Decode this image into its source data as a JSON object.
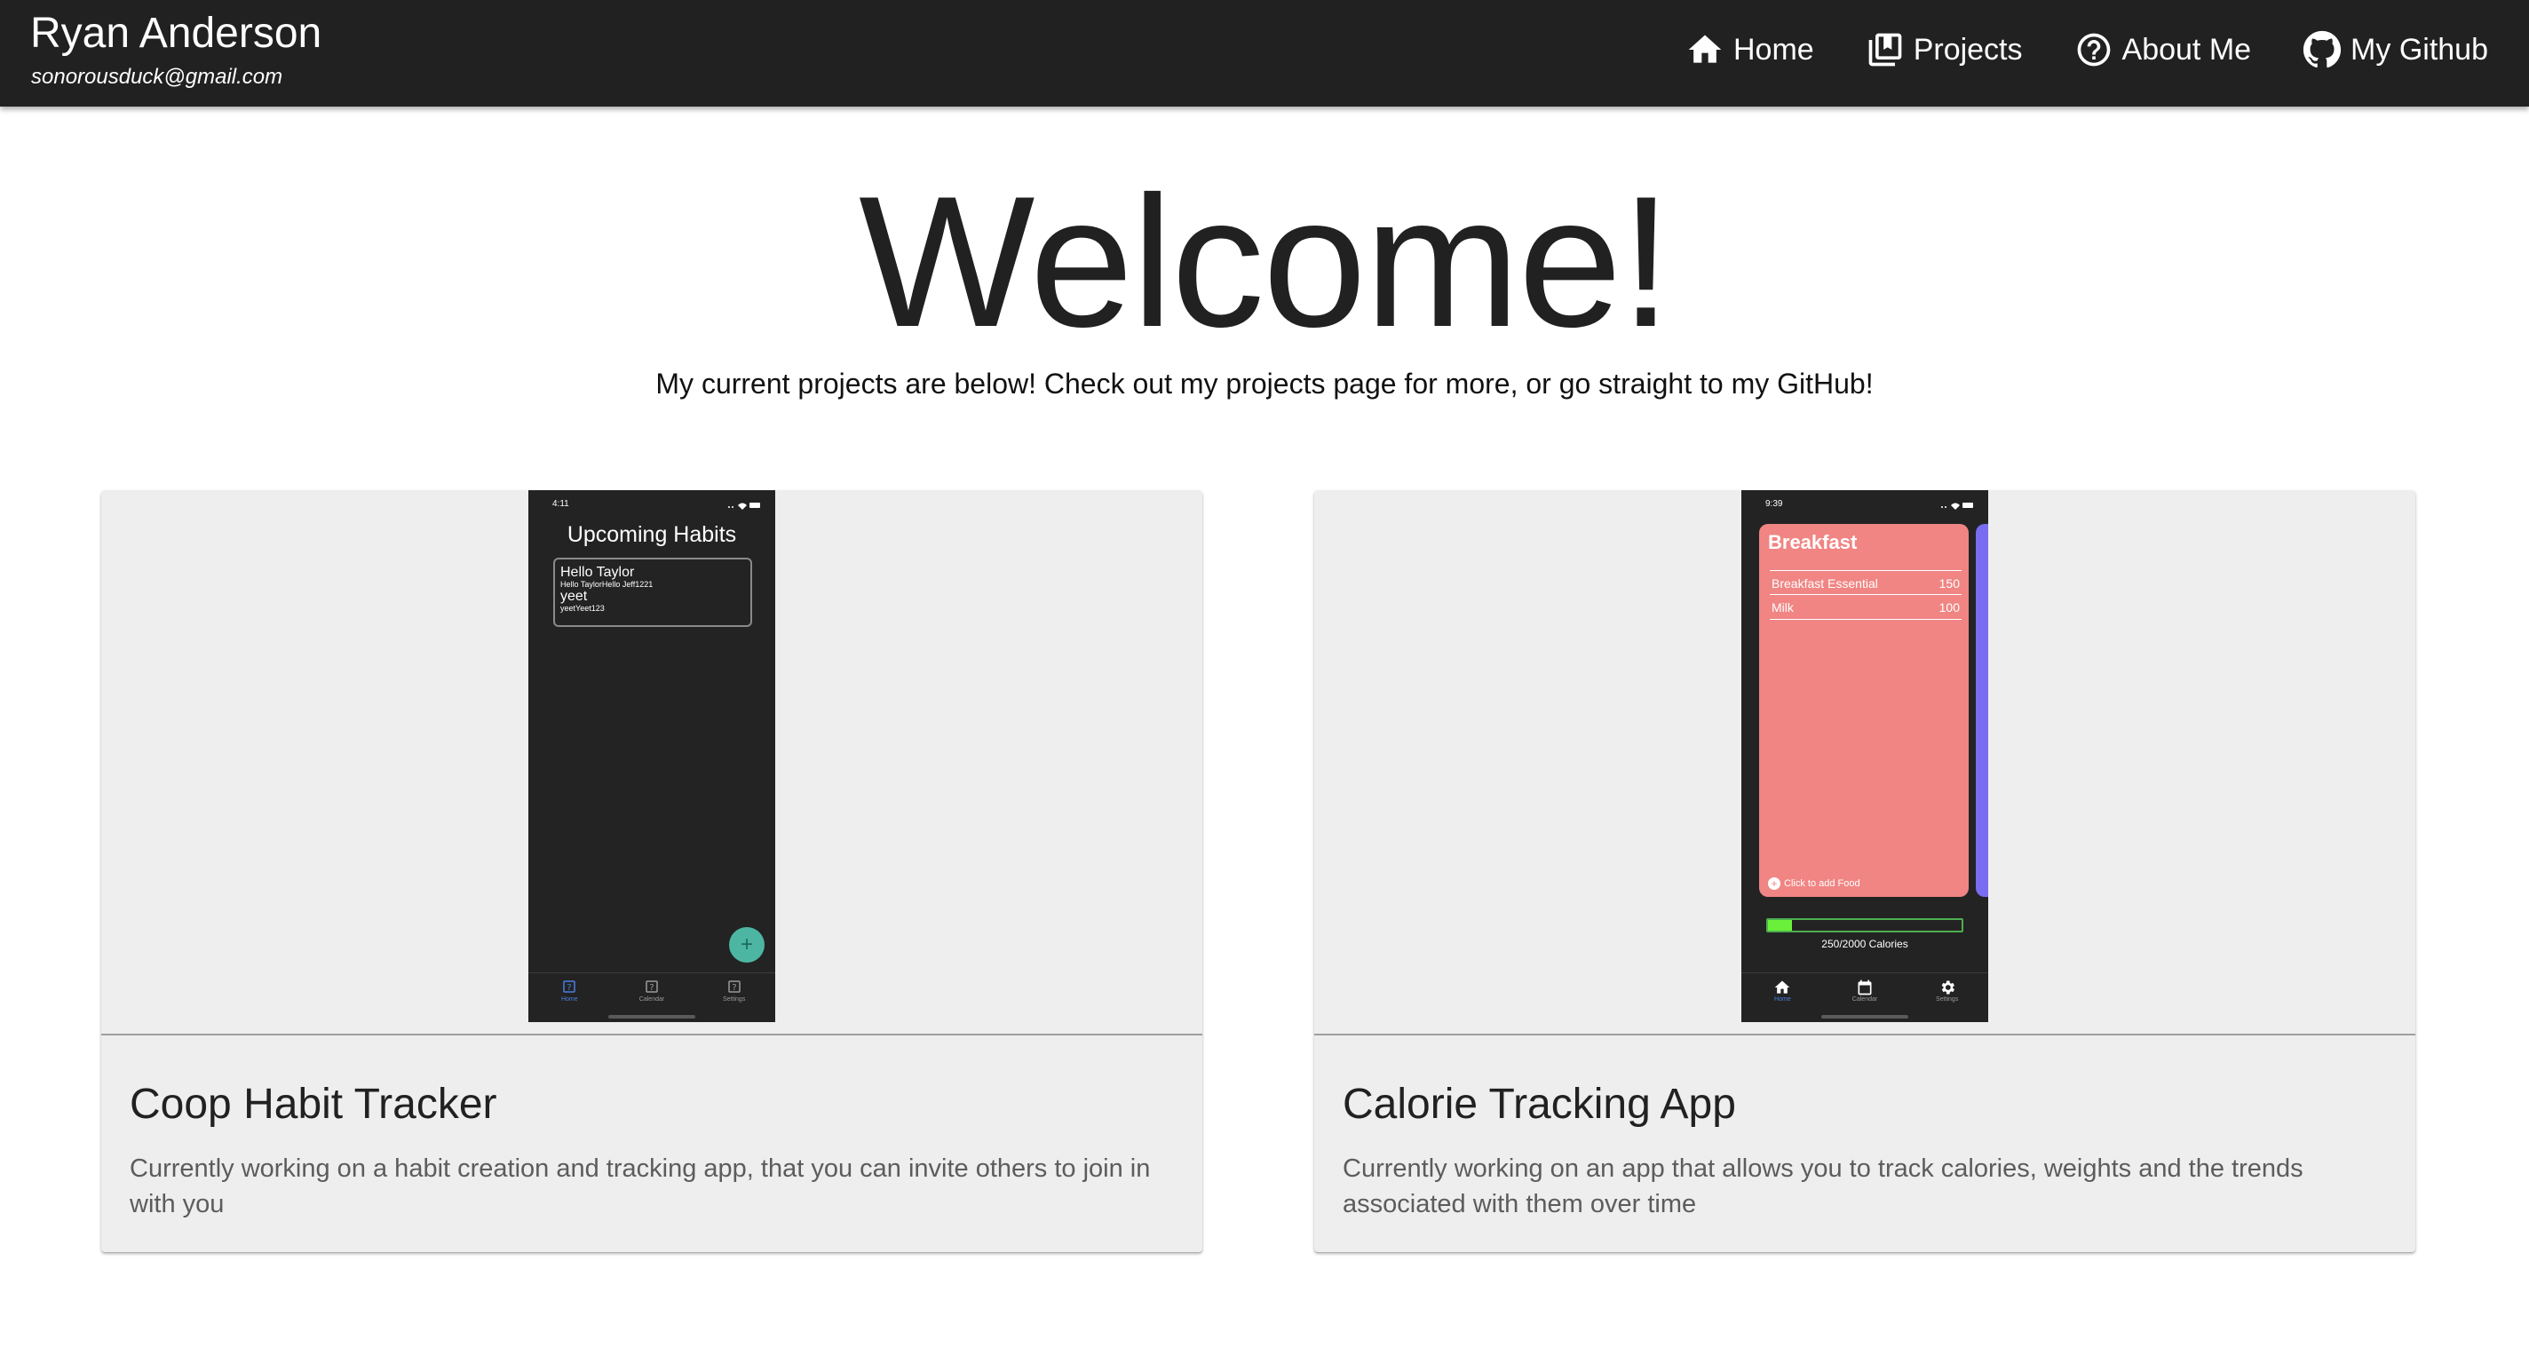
{
  "header": {
    "name": "Ryan Anderson",
    "email": "sonorousduck@gmail.com",
    "nav": [
      {
        "label": "Home",
        "icon": "home-icon"
      },
      {
        "label": "Projects",
        "icon": "library-books-icon"
      },
      {
        "label": "About Me",
        "icon": "help-circle-icon"
      },
      {
        "label": "My Github",
        "icon": "github-icon"
      }
    ],
    "background": "#212121"
  },
  "hero": {
    "title": "Welcome!",
    "subtitle": "My current projects are below! Check out my projects page for more, or go straight to my GitHub!"
  },
  "projects": [
    {
      "title": "Coop Habit Tracker",
      "description": "Currently working on a habit creation and tracking app, that you can invite others to join in with you",
      "screenshot": {
        "time": "4:11",
        "heading": "Upcoming Habits",
        "habits": [
          {
            "name": "Hello Taylor",
            "detail": "Hello TaylorHello Jeff1221"
          },
          {
            "name": "yeet",
            "detail": "yeetYeet123"
          }
        ],
        "fab": "+",
        "tabs": [
          "Home",
          "Calendar",
          "Settings"
        ],
        "accent": "#4db6a2"
      }
    },
    {
      "title": "Calorie Tracking App",
      "description": "Currently working on an app that allows you to track calories, weights and the trends associated with them over time",
      "screenshot": {
        "time": "9:39",
        "meal": "Breakfast",
        "foods": [
          {
            "name": "Breakfast Essential",
            "calories": "150"
          },
          {
            "name": "Milk",
            "calories": "100"
          }
        ],
        "add_food": "Click to add Food",
        "progress_text": "250/2000 Calories",
        "progress_fraction": 0.125,
        "tabs": [
          "Home",
          "Calendar",
          "Settings"
        ],
        "meal_color": "#f08583"
      }
    }
  ]
}
